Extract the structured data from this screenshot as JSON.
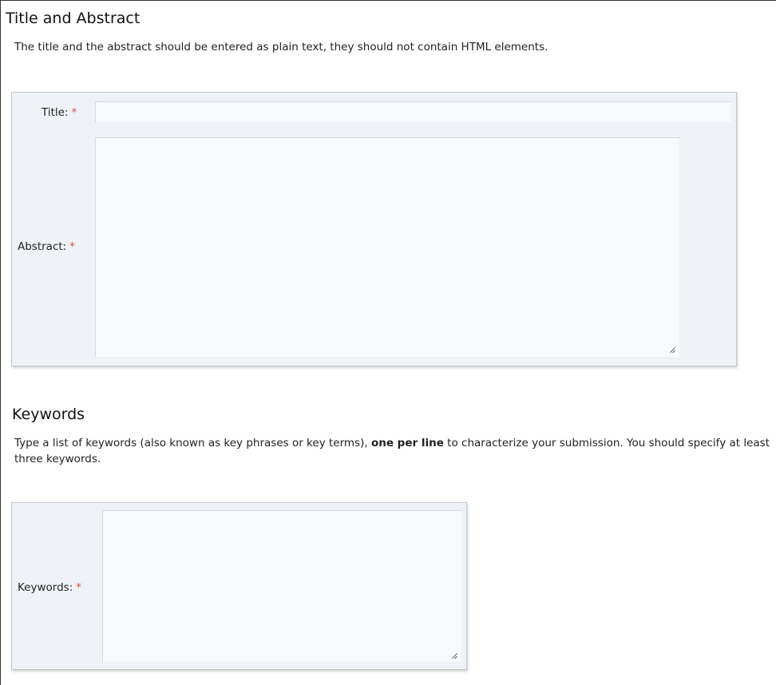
{
  "title_abstract_section": {
    "heading": "Title and Abstract",
    "description": "The title and the abstract should be entered as plain text, they should not contain HTML elements.",
    "title_label": "Title:",
    "title_value": "",
    "abstract_label": "Abstract:",
    "abstract_value": ""
  },
  "keywords_section": {
    "heading": "Keywords",
    "description_before": "Type a list of keywords (also known as key phrases or key terms), ",
    "description_bold": "one per line",
    "description_after": " to characterize your submission. You should specify at least three keywords.",
    "keywords_label": "Keywords:",
    "keywords_value": ""
  },
  "required_marker": "*",
  "colors": {
    "required": "#d9534f",
    "panel_background": "#eff2f6",
    "field_background": "#f7fafd"
  }
}
